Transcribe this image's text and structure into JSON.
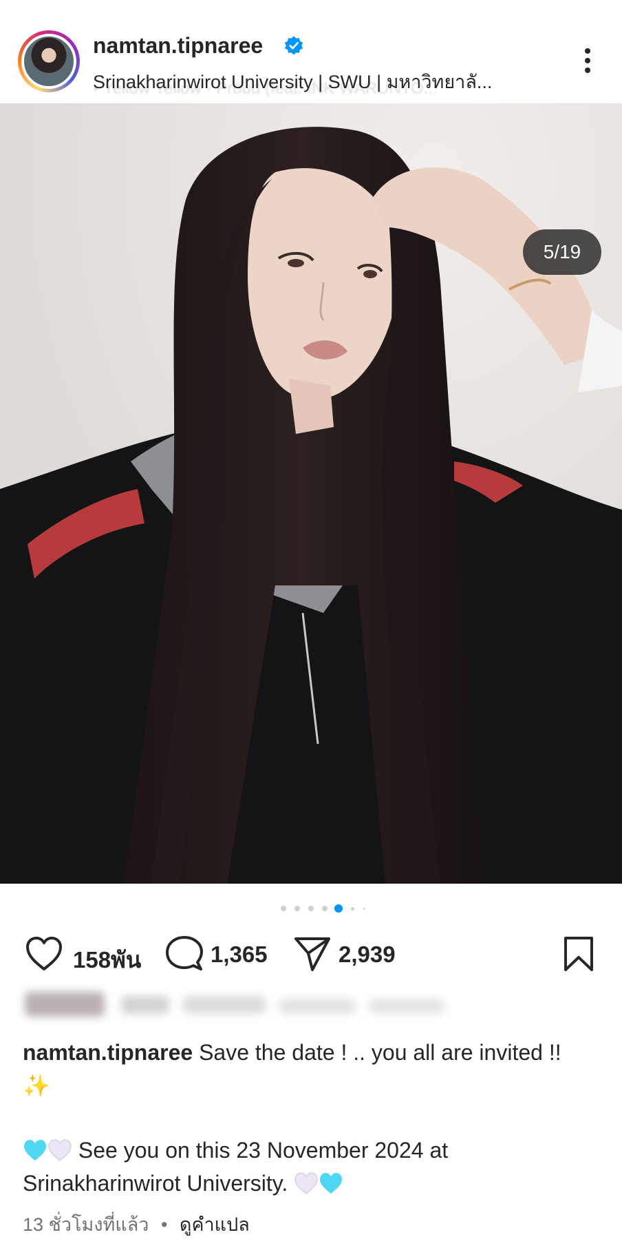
{
  "header": {
    "username": "namtan.tipnaree",
    "location": "Srinakharinwirot University | SWU | มหาวิทยาลั...",
    "music": "• Yellow Yellow - Proud (feat. INK WARUNTO..."
  },
  "post": {
    "slide_counter": "5/19",
    "slide_progress": {
      "current": 5,
      "total": 19
    }
  },
  "actions": {
    "likes": "158พัน",
    "comments": "1,365",
    "shares": "2,939"
  },
  "caption": {
    "username": "namtan.tipnaree",
    "line1": " Save the date ! .. you all are invited !! ✨",
    "line2": " See you on this 23 November 2024 at Srinakharinwirot University. "
  },
  "footer": {
    "time": "13 ชั่วโมงที่แล้ว",
    "separator": "•",
    "translate": "ดูคำแปล"
  },
  "colors": {
    "verified": "#0095f6",
    "dot_active": "#0095f6",
    "text": "#262626",
    "muted": "#737373",
    "heart_cyan": "#4fd6f2",
    "heart_white": "#ece6f4"
  },
  "icons": [
    "verified-badge-icon",
    "more-options-icon",
    "mute-icon",
    "heart-icon",
    "comment-icon",
    "share-icon",
    "bookmark-icon"
  ]
}
